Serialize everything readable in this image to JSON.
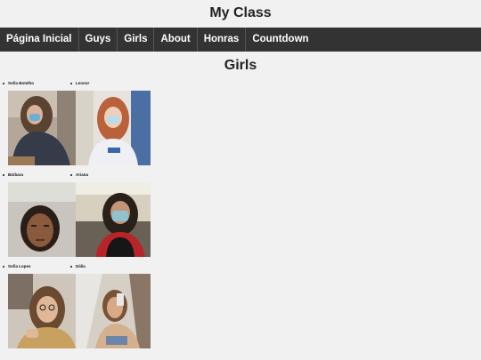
{
  "site": {
    "title": "My Class"
  },
  "nav": {
    "items": [
      {
        "label": "Página Inicial"
      },
      {
        "label": "Guys"
      },
      {
        "label": "Girls"
      },
      {
        "label": "About"
      },
      {
        "label": "Honras"
      },
      {
        "label": "Countdown"
      }
    ]
  },
  "page": {
    "heading": "Girls"
  },
  "students": [
    {
      "name": "Sofia Botelho"
    },
    {
      "name": "Leonor"
    },
    {
      "name": "Bárbara"
    },
    {
      "name": "Ariana"
    },
    {
      "name": "Sofia Lopes"
    },
    {
      "name": "Dália"
    }
  ]
}
